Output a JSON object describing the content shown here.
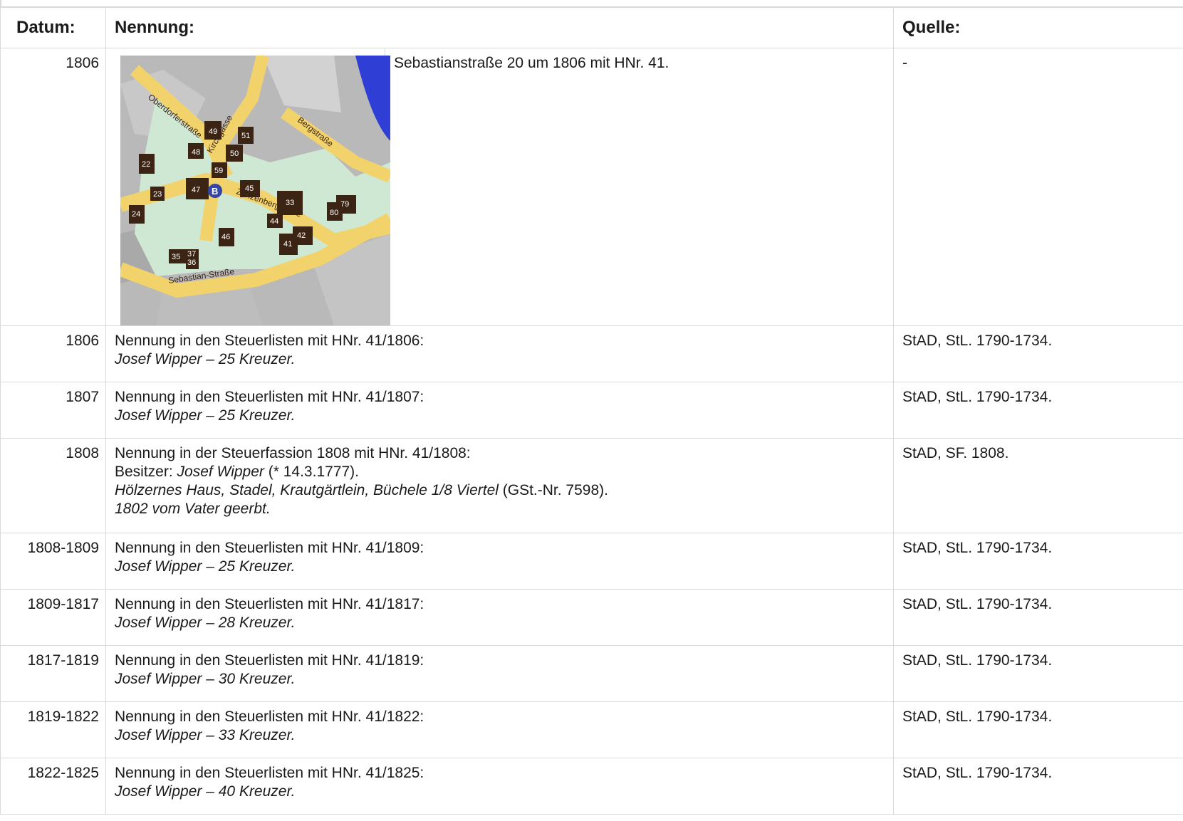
{
  "headers": {
    "date": "Datum:",
    "mention": "Nennung:",
    "source": "Quelle:"
  },
  "map": {
    "streets": [
      "Oberdorferstraße",
      "Kirchgasse",
      "Bergstraße",
      "Zanzenberggasse",
      "Sebastian-Straße"
    ],
    "house_numbers": [
      "49",
      "51",
      "48",
      "50",
      "22",
      "59",
      "47",
      "45",
      "33",
      "23",
      "79",
      "80",
      "24",
      "44",
      "42",
      "46",
      "41",
      "37",
      "36",
      "35"
    ],
    "marker": "B"
  },
  "rows": [
    {
      "date": "1806",
      "text": "Sebastianstraße 20 um 1806 mit HNr. 41.",
      "source": "-"
    },
    {
      "date": "1806",
      "line1": "Nennung in den Steuerlisten mit HNr. 41/1806:",
      "line2": "Josef Wipper – 25 Kreuzer.",
      "source": "StAD, StL. 1790-1734."
    },
    {
      "date": "1807",
      "line1": "Nennung in den Steuerlisten mit HNr. 41/1807:",
      "line2": "Josef Wipper – 25 Kreuzer.",
      "source": "StAD, StL. 1790-1734."
    },
    {
      "date": "1808",
      "line1": "Nennung in der Steuerfassion 1808 mit HNr. 41/1808:",
      "owner_label": "Besitzer: ",
      "owner_name": "Josef Wipper",
      "owner_birth": " (* 14.3.1777).",
      "property": "Hölzernes Haus, Stadel, Krautgärtlein, Büchele 1/8 Viertel",
      "property_ref": " (GSt.-Nr. 7598).",
      "inherit": "1802 vom Vater geerbt.",
      "source": "StAD, SF. 1808."
    },
    {
      "date": "1808-1809",
      "line1": "Nennung in den Steuerlisten mit HNr. 41/1809:",
      "line2": "Josef Wipper – 25 Kreuzer.",
      "source": "StAD, StL. 1790-1734."
    },
    {
      "date": "1809-1817",
      "line1": "Nennung in den Steuerlisten mit HNr. 41/1817:",
      "line2": "Josef Wipper – 28 Kreuzer.",
      "source": "StAD, StL. 1790-1734."
    },
    {
      "date": "1817-1819",
      "line1": "Nennung in den Steuerlisten mit HNr. 41/1819:",
      "line2": "Josef Wipper – 30 Kreuzer.",
      "source": "StAD, StL. 1790-1734."
    },
    {
      "date": "1819-1822",
      "line1": "Nennung in den Steuerlisten mit HNr. 41/1822:",
      "line2": "Josef Wipper – 33 Kreuzer.",
      "source": "StAD, StL. 1790-1734."
    },
    {
      "date": "1822-1825",
      "line1": "Nennung in den Steuerlisten mit HNr. 41/1825:",
      "line2": "Josef Wipper – 40 Kreuzer.",
      "source": "StAD, StL. 1790-1734."
    }
  ],
  "colors": {
    "street": "#f2d36b",
    "green_area": "#cfe8d4",
    "house": "#3b2414",
    "river": "#2f3fd6",
    "marker": "#3346a8"
  }
}
